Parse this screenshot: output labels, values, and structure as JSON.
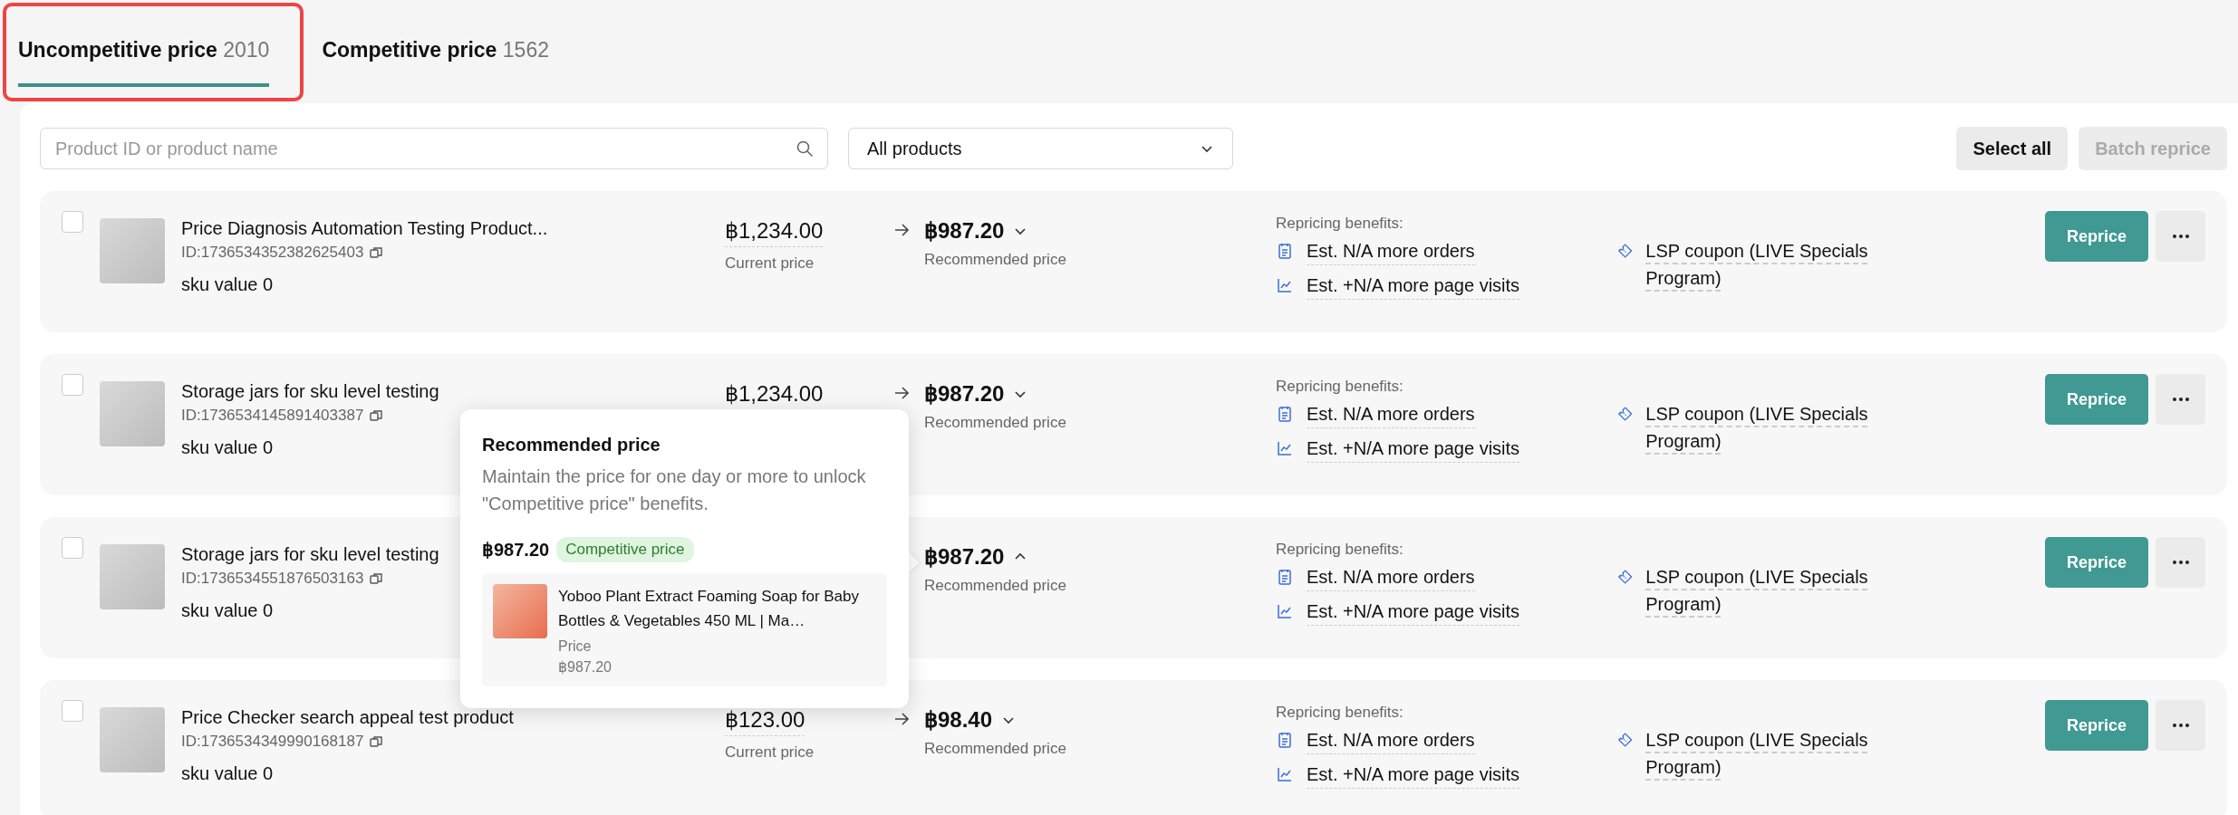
{
  "tabs": [
    {
      "label": "Uncompetitive price",
      "count": "2010",
      "selected": true,
      "highlighted": true
    },
    {
      "label": "Competitive price",
      "count": "1562",
      "selected": false,
      "highlighted": false
    }
  ],
  "toolbar": {
    "search": {
      "placeholder": "Product ID or product name"
    },
    "filter": {
      "value": "All products"
    },
    "buttons": [
      {
        "label": "Select all",
        "disabled": false
      },
      {
        "label": "Batch reprice",
        "disabled": true
      }
    ]
  },
  "products": [
    {
      "checked": false,
      "title": "Price Diagnosis Automation Testing Product...",
      "id": "ID:1736534352382625403",
      "sku": "sku value 0",
      "current_price": "฿1,234.00",
      "current_label": "Current price",
      "recommended_price": "฿987.20",
      "recommended_label": "Recommended price",
      "expanded": false,
      "benefits_title": "Repricing benefits:",
      "benefits": [
        {
          "kind": "orders",
          "text": "Est. N/A more orders"
        },
        {
          "kind": "visits",
          "text": "Est. +N/A more page visits"
        },
        {
          "kind": "coupon",
          "text": "LSP coupon (LIVE Specials Program)"
        }
      ],
      "action": "Reprice"
    },
    {
      "checked": false,
      "title": "Storage jars for sku level testing",
      "id": "ID:1736534145891403387",
      "sku": "sku value 0",
      "current_price": "฿1,234.00",
      "recommended_price": "฿987.20",
      "recommended_label": "Recommended price",
      "expanded": false,
      "benefits_title": "Repricing benefits:",
      "benefits": [
        {
          "kind": "orders",
          "text": "Est. N/A more orders"
        },
        {
          "kind": "visits",
          "text": "Est. +N/A more page visits"
        },
        {
          "kind": "coupon",
          "text": "LSP coupon (LIVE Specials Program)"
        }
      ],
      "action": "Reprice"
    },
    {
      "checked": false,
      "title": "Storage jars for sku level testing",
      "id": "ID:1736534551876503163",
      "sku": "sku value 0",
      "recommended_price": "฿987.20",
      "recommended_label": "Recommended price",
      "expanded": true,
      "benefits_title": "Repricing benefits:",
      "benefits": [
        {
          "kind": "orders",
          "text": "Est. N/A more orders"
        },
        {
          "kind": "visits",
          "text": "Est. +N/A more page visits"
        },
        {
          "kind": "coupon",
          "text": "LSP coupon (LIVE Specials Program)"
        }
      ],
      "action": "Reprice"
    },
    {
      "checked": false,
      "title": "Price Checker search appeal test product",
      "id": "ID:1736534349990168187",
      "sku": "sku value 0",
      "current_price": "฿123.00",
      "current_label": "Current price",
      "recommended_price": "฿98.40",
      "recommended_label": "Recommended price",
      "expanded": false,
      "benefits_title": "Repricing benefits:",
      "benefits": [
        {
          "kind": "orders",
          "text": "Est. N/A more orders"
        },
        {
          "kind": "visits",
          "text": "Est. +N/A more page visits"
        },
        {
          "kind": "coupon",
          "text": "LSP coupon (LIVE Specials Program)"
        }
      ],
      "action": "Reprice"
    }
  ],
  "popover": {
    "title": "Recommended price",
    "description": "Maintain the price for one day or more to unlock \"Competitive price\" benefits.",
    "price": "฿987.20",
    "tag": "Competitive price",
    "product": {
      "name": "Yoboo Plant Extract Foaming Soap for Baby Bottles & Vegetables 450 ML | Ma…",
      "price_label": "Price",
      "price": "฿987.20"
    }
  }
}
